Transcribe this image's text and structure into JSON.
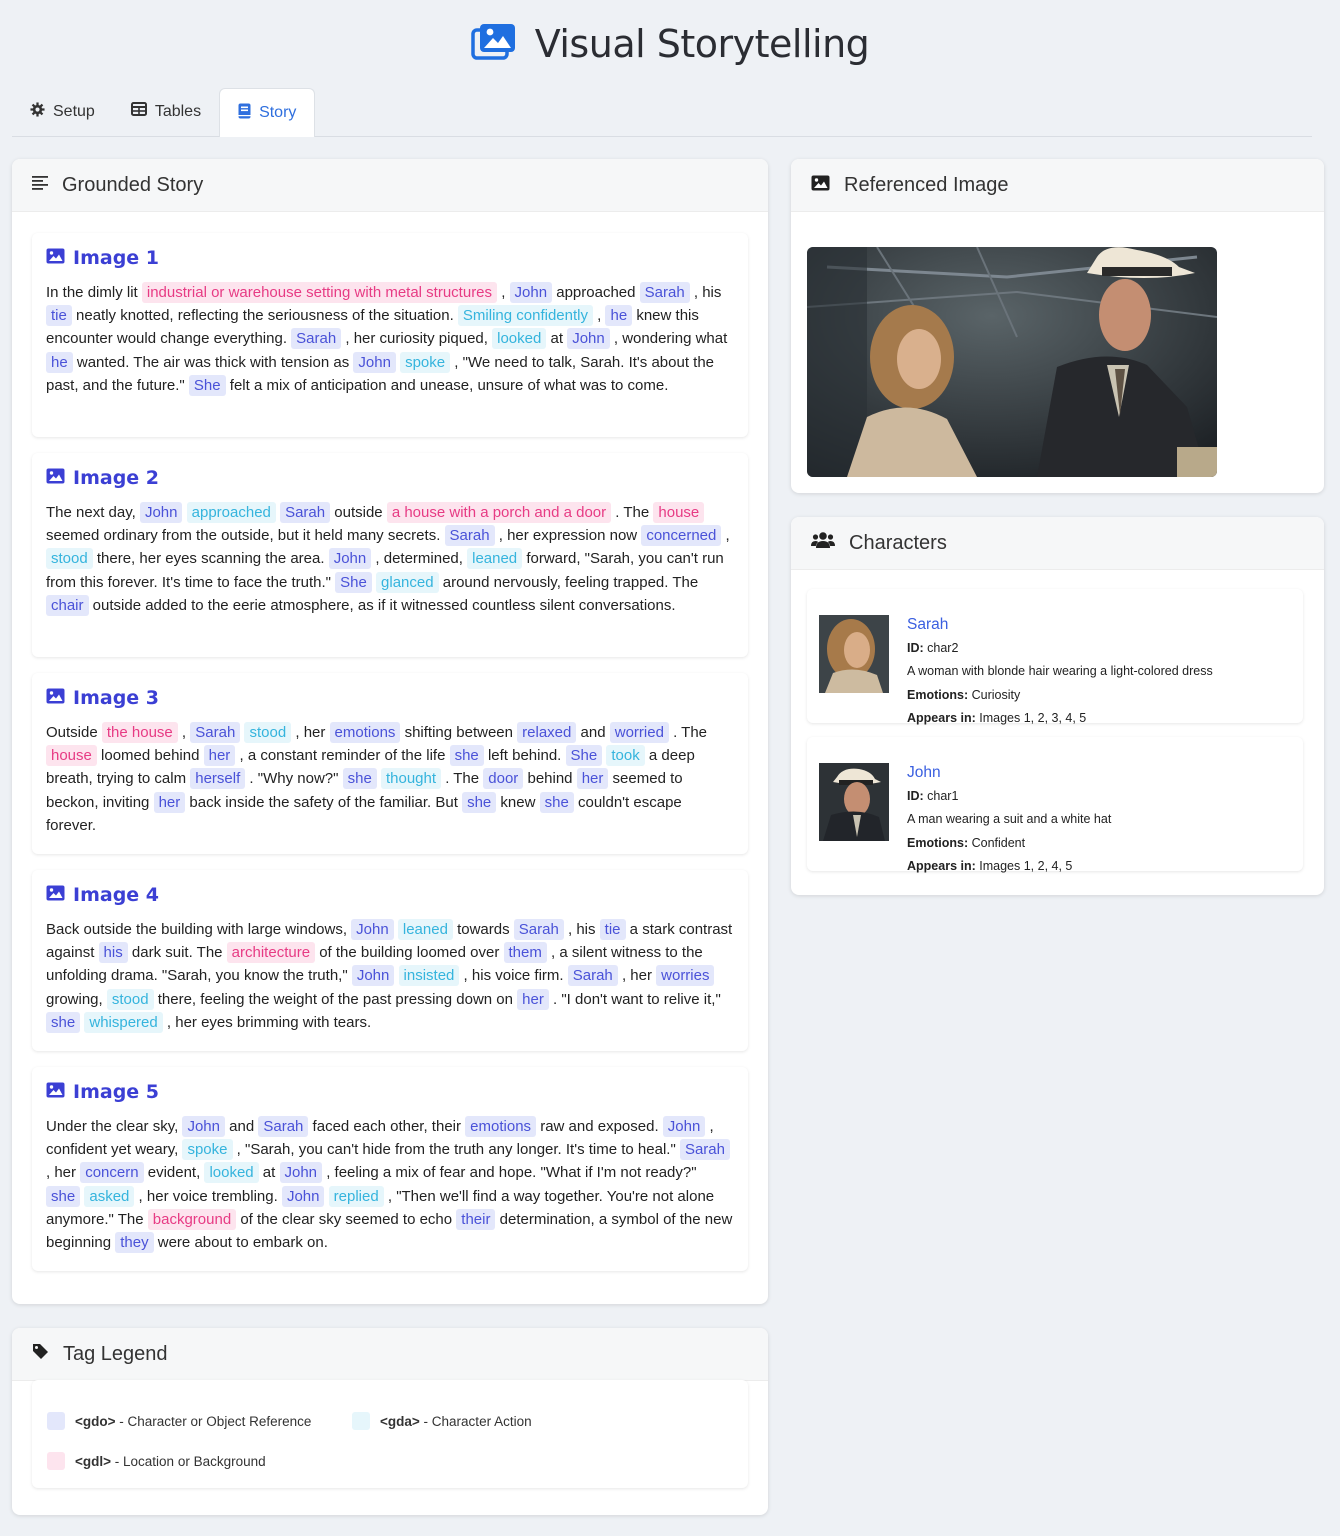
{
  "app": {
    "title": "Visual Storytelling",
    "icon": "images-icon"
  },
  "tabs": [
    {
      "label": "Setup",
      "icon": "gear-icon",
      "active": false
    },
    {
      "label": "Tables",
      "icon": "table-icon",
      "active": false
    },
    {
      "label": "Story",
      "icon": "book-icon",
      "active": true
    }
  ],
  "story_panel": {
    "title": "Grounded Story",
    "icon": "align-left-icon"
  },
  "story": [
    {
      "title": "Image 1",
      "segments": [
        [
          "t",
          "In the dimly lit "
        ],
        [
          "gdl",
          "industrial or warehouse setting with metal structures"
        ],
        [
          "t",
          " , "
        ],
        [
          "gdo",
          "John"
        ],
        [
          "t",
          " approached "
        ],
        [
          "gdo",
          "Sarah"
        ],
        [
          "t",
          " , his "
        ],
        [
          "gdo",
          "tie"
        ],
        [
          "t",
          " neatly knotted, reflecting the seriousness of the situation. "
        ],
        [
          "gda",
          "Smiling confidently"
        ],
        [
          "t",
          " , "
        ],
        [
          "gdo",
          "he"
        ],
        [
          "t",
          " knew this encounter would change everything. "
        ],
        [
          "gdo",
          "Sarah"
        ],
        [
          "t",
          " , her curiosity piqued, "
        ],
        [
          "gda",
          "looked"
        ],
        [
          "t",
          " at "
        ],
        [
          "gdo",
          "John"
        ],
        [
          "t",
          " , wondering what "
        ],
        [
          "gdo",
          "he"
        ],
        [
          "t",
          " wanted. The air was thick with tension as "
        ],
        [
          "gdo",
          "John"
        ],
        [
          "t",
          " "
        ],
        [
          "gda",
          "spoke"
        ],
        [
          "t",
          " , \"We need to talk, Sarah. It's about the past, and the future.\" "
        ],
        [
          "gdo",
          "She"
        ],
        [
          "t",
          " felt a mix of anticipation and unease, unsure of what was to come."
        ]
      ]
    },
    {
      "title": "Image 2",
      "segments": [
        [
          "t",
          "The next day, "
        ],
        [
          "gdo",
          "John"
        ],
        [
          "t",
          " "
        ],
        [
          "gda",
          "approached"
        ],
        [
          "t",
          " "
        ],
        [
          "gdo",
          "Sarah"
        ],
        [
          "t",
          " outside "
        ],
        [
          "gdl",
          "a house with a porch and a door"
        ],
        [
          "t",
          " . The "
        ],
        [
          "gdl",
          "house"
        ],
        [
          "t",
          " seemed ordinary from the outside, but it held many secrets. "
        ],
        [
          "gdo",
          "Sarah"
        ],
        [
          "t",
          " , her expression now "
        ],
        [
          "gdo",
          "concerned"
        ],
        [
          "t",
          " , "
        ],
        [
          "gda",
          "stood"
        ],
        [
          "t",
          " there, her eyes scanning the area. "
        ],
        [
          "gdo",
          "John"
        ],
        [
          "t",
          " , determined, "
        ],
        [
          "gda",
          "leaned"
        ],
        [
          "t",
          " forward, \"Sarah, you can't run from this forever. It's time to face the truth.\" "
        ],
        [
          "gdo",
          "She"
        ],
        [
          "t",
          " "
        ],
        [
          "gda",
          "glanced"
        ],
        [
          "t",
          " around nervously, feeling trapped. The "
        ],
        [
          "gdo",
          "chair"
        ],
        [
          "t",
          " outside added to the eerie atmosphere, as if it witnessed countless silent conversations."
        ]
      ]
    },
    {
      "title": "Image 3",
      "segments": [
        [
          "t",
          "Outside "
        ],
        [
          "gdl",
          "the house"
        ],
        [
          "t",
          " , "
        ],
        [
          "gdo",
          "Sarah"
        ],
        [
          "t",
          " "
        ],
        [
          "gda",
          "stood"
        ],
        [
          "t",
          " , her "
        ],
        [
          "gdo",
          "emotions"
        ],
        [
          "t",
          " shifting between "
        ],
        [
          "gdo",
          "relaxed"
        ],
        [
          "t",
          " and "
        ],
        [
          "gdo",
          "worried"
        ],
        [
          "t",
          " . The "
        ],
        [
          "gdl",
          "house"
        ],
        [
          "t",
          " loomed behind "
        ],
        [
          "gdo",
          "her"
        ],
        [
          "t",
          " , a constant reminder of the life "
        ],
        [
          "gdo",
          "she"
        ],
        [
          "t",
          " left behind. "
        ],
        [
          "gdo",
          "She"
        ],
        [
          "t",
          " "
        ],
        [
          "gda",
          "took"
        ],
        [
          "t",
          " a deep breath, trying to calm "
        ],
        [
          "gdo",
          "herself"
        ],
        [
          "t",
          " . \"Why now?\" "
        ],
        [
          "gdo",
          "she"
        ],
        [
          "t",
          " "
        ],
        [
          "gda",
          "thought"
        ],
        [
          "t",
          " . The "
        ],
        [
          "gdo",
          "door"
        ],
        [
          "t",
          " behind "
        ],
        [
          "gdo",
          "her"
        ],
        [
          "t",
          " seemed to beckon, inviting "
        ],
        [
          "gdo",
          "her"
        ],
        [
          "t",
          " back inside the safety of the familiar. But "
        ],
        [
          "gdo",
          "she"
        ],
        [
          "t",
          " knew "
        ],
        [
          "gdo",
          "she"
        ],
        [
          "t",
          " couldn't escape forever."
        ]
      ]
    },
    {
      "title": "Image 4",
      "segments": [
        [
          "t",
          "Back outside the building with large windows, "
        ],
        [
          "gdo",
          "John"
        ],
        [
          "t",
          " "
        ],
        [
          "gda",
          "leaned"
        ],
        [
          "t",
          " towards "
        ],
        [
          "gdo",
          "Sarah"
        ],
        [
          "t",
          " , his "
        ],
        [
          "gdo",
          "tie"
        ],
        [
          "t",
          " a stark contrast against "
        ],
        [
          "gdo",
          "his"
        ],
        [
          "t",
          " dark suit. The "
        ],
        [
          "gdl",
          "architecture"
        ],
        [
          "t",
          " of the building loomed over "
        ],
        [
          "gdo",
          "them"
        ],
        [
          "t",
          " , a silent witness to the unfolding drama. \"Sarah, you know the truth,\" "
        ],
        [
          "gdo",
          "John"
        ],
        [
          "t",
          " "
        ],
        [
          "gda",
          "insisted"
        ],
        [
          "t",
          " , his voice firm. "
        ],
        [
          "gdo",
          "Sarah"
        ],
        [
          "t",
          " , her "
        ],
        [
          "gdo",
          "worries"
        ],
        [
          "t",
          " growing, "
        ],
        [
          "gda",
          "stood"
        ],
        [
          "t",
          " there, feeling the weight of the past pressing down on "
        ],
        [
          "gdo",
          "her"
        ],
        [
          "t",
          " . \"I don't want to relive it,\" "
        ],
        [
          "gdo",
          "she"
        ],
        [
          "t",
          " "
        ],
        [
          "gda",
          "whispered"
        ],
        [
          "t",
          " , her eyes brimming with tears."
        ]
      ]
    },
    {
      "title": "Image 5",
      "segments": [
        [
          "t",
          "Under the clear sky, "
        ],
        [
          "gdo",
          "John"
        ],
        [
          "t",
          " and "
        ],
        [
          "gdo",
          "Sarah"
        ],
        [
          "t",
          " faced each other, their "
        ],
        [
          "gdo",
          "emotions"
        ],
        [
          "t",
          " raw and exposed. "
        ],
        [
          "gdo",
          "John"
        ],
        [
          "t",
          " , confident yet weary, "
        ],
        [
          "gda",
          "spoke"
        ],
        [
          "t",
          " , \"Sarah, you can't hide from the truth any longer. It's time to heal.\" "
        ],
        [
          "gdo",
          "Sarah"
        ],
        [
          "t",
          " , her "
        ],
        [
          "gdo",
          "concern"
        ],
        [
          "t",
          " evident, "
        ],
        [
          "gda",
          "looked"
        ],
        [
          "t",
          " at "
        ],
        [
          "gdo",
          "John"
        ],
        [
          "t",
          " , feeling a mix of fear and hope. \"What if I'm not ready?\" "
        ],
        [
          "gdo",
          "she"
        ],
        [
          "t",
          " "
        ],
        [
          "gda",
          "asked"
        ],
        [
          "t",
          " , her voice trembling. "
        ],
        [
          "gdo",
          "John"
        ],
        [
          "t",
          " "
        ],
        [
          "gda",
          "replied"
        ],
        [
          "t",
          " , \"Then we'll find a way together. You're not alone anymore.\" The "
        ],
        [
          "gdl",
          "background"
        ],
        [
          "t",
          " of the clear sky seemed to echo "
        ],
        [
          "gdo",
          "their"
        ],
        [
          "t",
          " determination, a symbol of the new beginning "
        ],
        [
          "gdo",
          "they"
        ],
        [
          "t",
          " were about to embark on."
        ]
      ]
    }
  ],
  "ref_image": {
    "title": "Referenced Image",
    "icon": "image-icon"
  },
  "characters_panel": {
    "title": "Characters",
    "icon": "users-icon"
  },
  "characters": [
    {
      "name": "Sarah",
      "id_label": "ID:",
      "id": "char2",
      "description": "A woman with blonde hair wearing a light-colored dress",
      "emotions_label": "Emotions:",
      "emotions": "Curiosity",
      "appears_label": "Appears in:",
      "appears": "Images 1, 2, 3, 4, 5"
    },
    {
      "name": "John",
      "id_label": "ID:",
      "id": "char1",
      "description": "A man wearing a suit and a white hat",
      "emotions_label": "Emotions:",
      "emotions": "Confident",
      "appears_label": "Appears in:",
      "appears": "Images 1, 2, 4, 5"
    }
  ],
  "legend": {
    "title": "Tag Legend",
    "icon": "tag-icon",
    "items": [
      {
        "tag": "<gdo>",
        "desc": "- Character or Object Reference",
        "color": "#e3e7fb"
      },
      {
        "tag": "<gda>",
        "desc": "- Character Action",
        "color": "#e6f6fb"
      },
      {
        "tag": "<gdl>",
        "desc": "- Location or Background",
        "color": "#fde4ee"
      }
    ]
  },
  "colors": {
    "accent": "#2f6fde",
    "image_title": "#3b3fd4",
    "gdo_text": "#4a52d8",
    "gda_text": "#35b4dd",
    "gdl_text": "#e73b84"
  }
}
